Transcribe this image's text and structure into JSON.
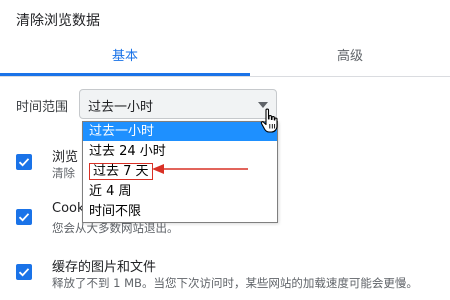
{
  "dialog": {
    "title": "清除浏览数据"
  },
  "tabs": {
    "basic": "基本",
    "advanced": "高级"
  },
  "time_range": {
    "label": "时间范围",
    "selected": "过去一小时",
    "options": [
      "过去一小时",
      "过去 24 小时",
      "过去 7 天",
      "近 4 周",
      "时间不限"
    ],
    "highlighted_index": 0,
    "annotated_index": 2
  },
  "items": [
    {
      "title": "浏览",
      "subtitle": "清除",
      "checked": true
    },
    {
      "title": "Cook",
      "subtitle": "您会从大多数网站退出。",
      "checked": true
    },
    {
      "title": "缓存的图片和文件",
      "subtitle": "释放了不到 1 MB。当您下次访问时，某些网站的加载速度可能会更慢。",
      "checked": true
    }
  ],
  "colors": {
    "accent": "#1a73e8",
    "dropdown_highlight": "#1e90ff",
    "annotation": "#d93025"
  },
  "icons": {
    "caret": "caret-down-icon",
    "cursor": "hand-pointer-icon",
    "check": "checkmark-icon",
    "arrow": "red-arrow-icon"
  }
}
